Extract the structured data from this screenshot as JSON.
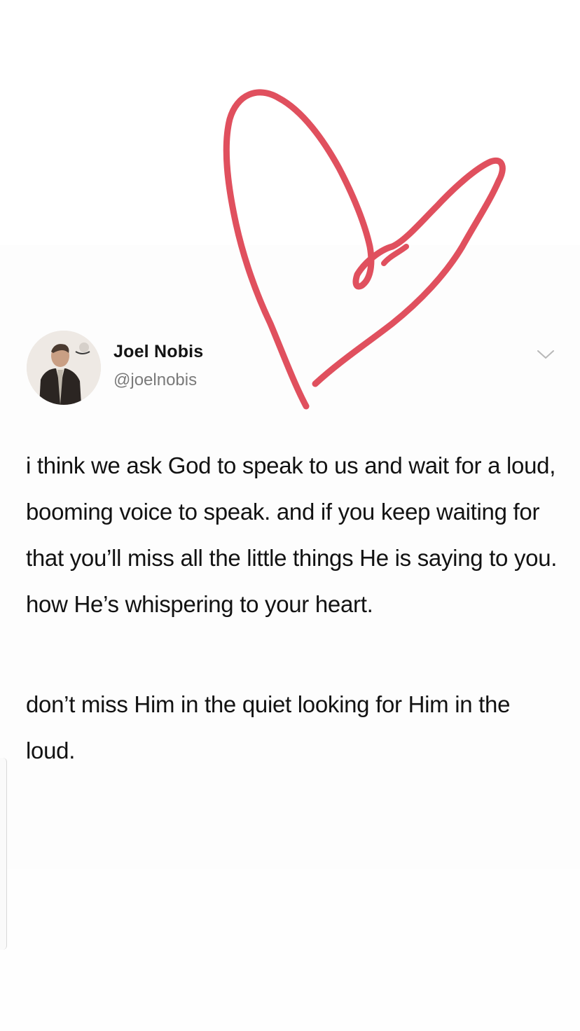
{
  "tweet": {
    "author_name": "Joel Nobis",
    "author_handle": "@joelnobis",
    "avatar_icon": "profile-photo",
    "menu_icon": "chevron-down-icon",
    "paragraphs": [
      "i think we ask God to speak to us and wait for a loud, booming voice to speak. and if you keep waiting for that you’ll miss all the little things He is saying to you. how He’s whispering to your heart.",
      "don’t miss Him in the quiet looking for Him in the loud."
    ]
  },
  "overlay": {
    "doodle": "heart-doodle",
    "stroke_color": "#e0505e"
  },
  "colors": {
    "background": "#fdfdfd",
    "name": "#141414",
    "handle": "#7a7a7a",
    "text": "#121212"
  }
}
